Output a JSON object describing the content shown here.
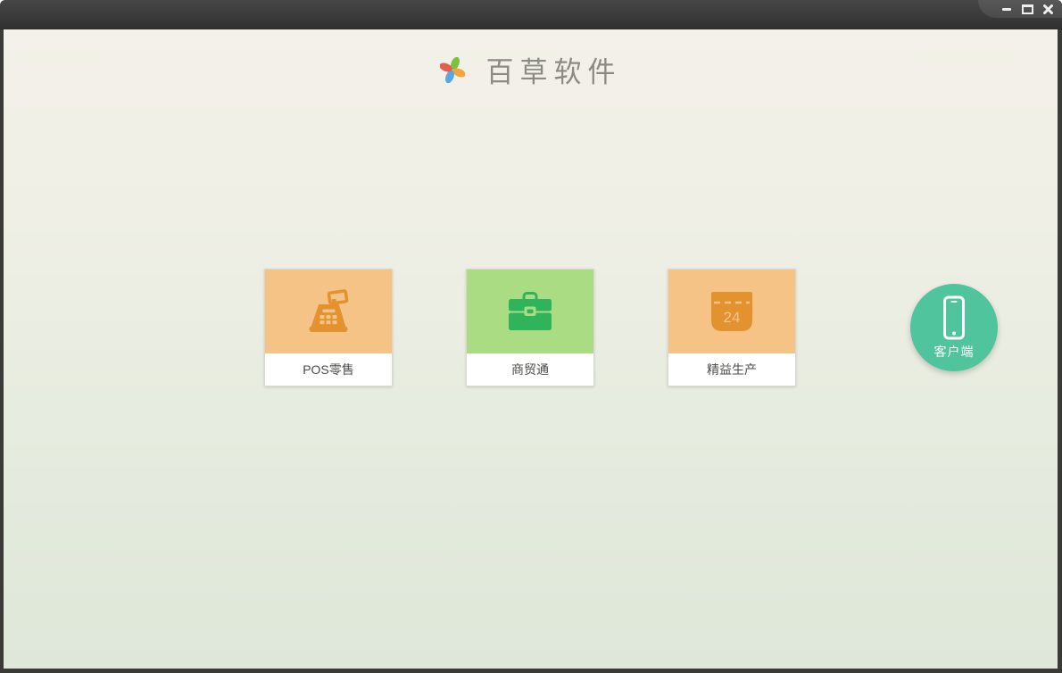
{
  "window": {
    "controls": [
      {
        "name": "minimize"
      },
      {
        "name": "maximize"
      },
      {
        "name": "close"
      }
    ]
  },
  "brand": {
    "app_name": "百草软件",
    "logo": "pinwheel-icon",
    "logo_colors": {
      "top": "#7dc13f",
      "right": "#f2a53d",
      "bottom": "#58a8e8",
      "left": "#e4604e"
    }
  },
  "products": [
    {
      "label": "POS零售",
      "icon": "cash-register-icon",
      "tile_color": "#f6c387",
      "icon_color": "#e2932f"
    },
    {
      "label": "商贸通",
      "icon": "briefcase-icon",
      "tile_color": "#a9dc83",
      "icon_color": "#2fb35b"
    },
    {
      "label": "精益生产",
      "icon": "calendar-icon",
      "calendar_day": "24",
      "tile_color": "#f6c387",
      "icon_color": "#e2932f"
    }
  ],
  "client": {
    "label": "客户端",
    "icon": "smartphone-icon",
    "color": "#4fc49d"
  },
  "theme": {
    "titlebar_top": "#474747",
    "titlebar_bottom": "#2f2f2f",
    "background_top": "#f3f1e9",
    "background_bottom": "#dee7d9",
    "title_text": "#8b8b84",
    "card_label_text": "#4c4c49"
  }
}
